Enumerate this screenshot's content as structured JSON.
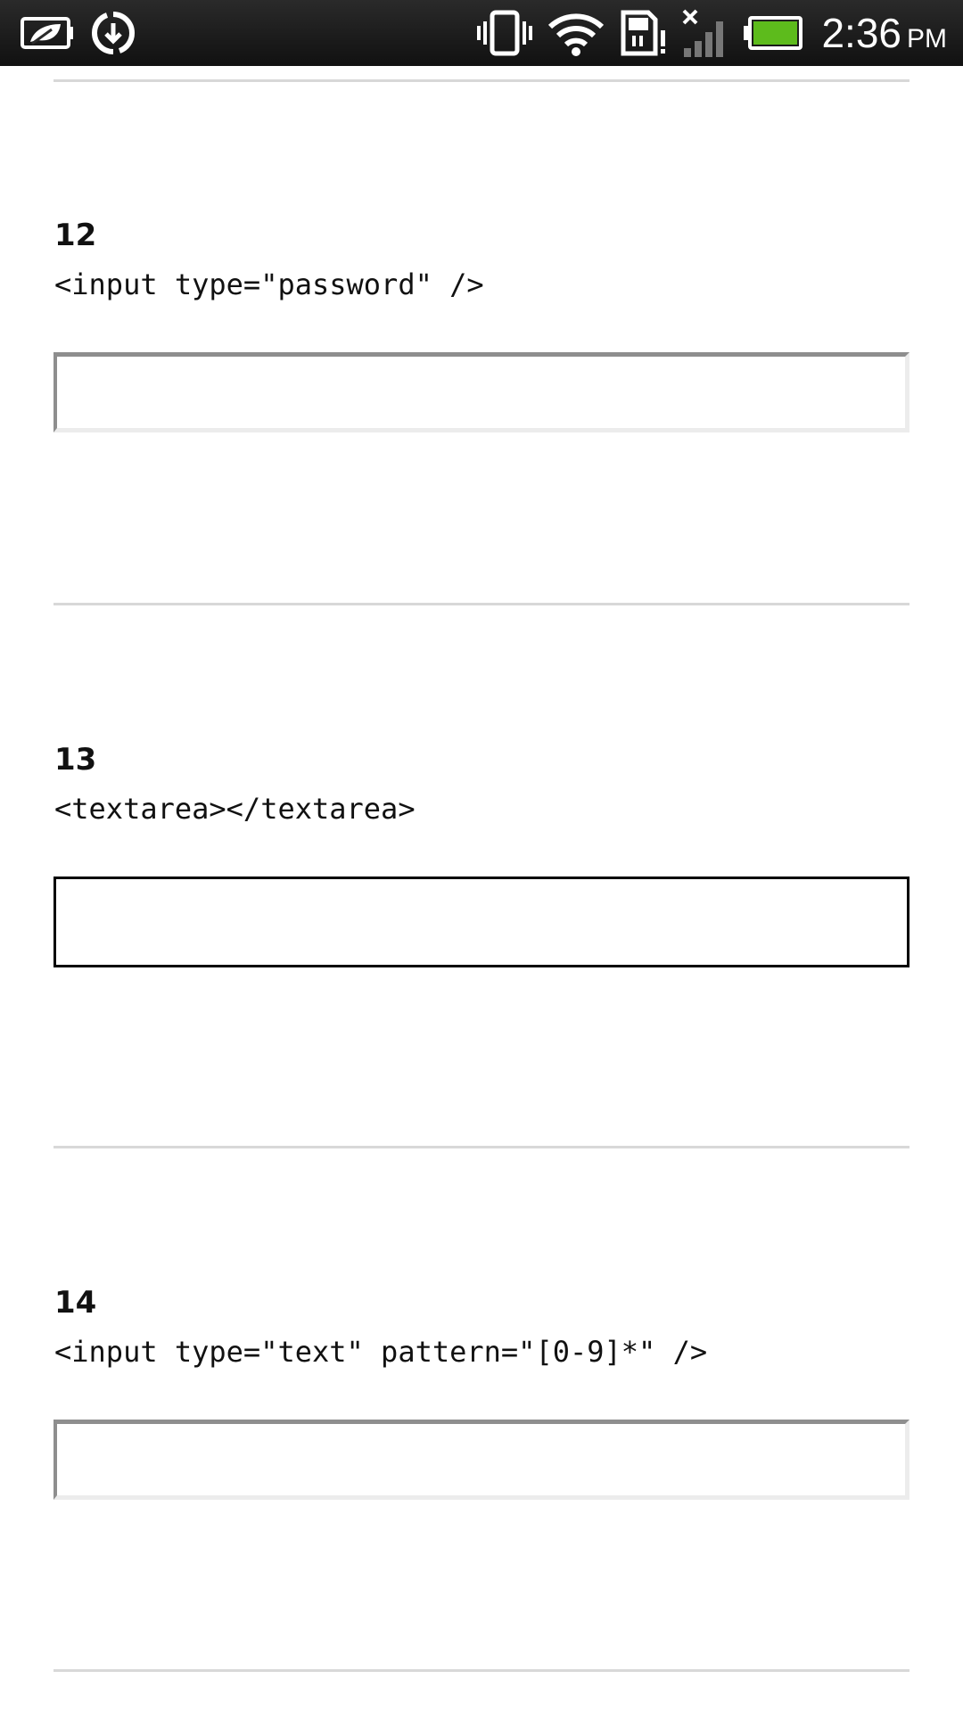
{
  "status_bar": {
    "time": "2:36",
    "ampm": "PM",
    "icons": [
      "power-saver-icon",
      "sync-icon",
      "vibrate-icon",
      "wifi-icon",
      "sd-card-warning-icon",
      "no-signal-icon",
      "battery-icon"
    ],
    "battery_color": "#5dbb1c"
  },
  "items": [
    {
      "number": "12",
      "code": "<input type=\"password\" />",
      "field_type": "password",
      "value": ""
    },
    {
      "number": "13",
      "code": "<textarea></textarea>",
      "field_type": "textarea",
      "value": ""
    },
    {
      "number": "14",
      "code": "<input type=\"text\" pattern=\"[0-9]*\" />",
      "field_type": "text",
      "value": ""
    }
  ]
}
